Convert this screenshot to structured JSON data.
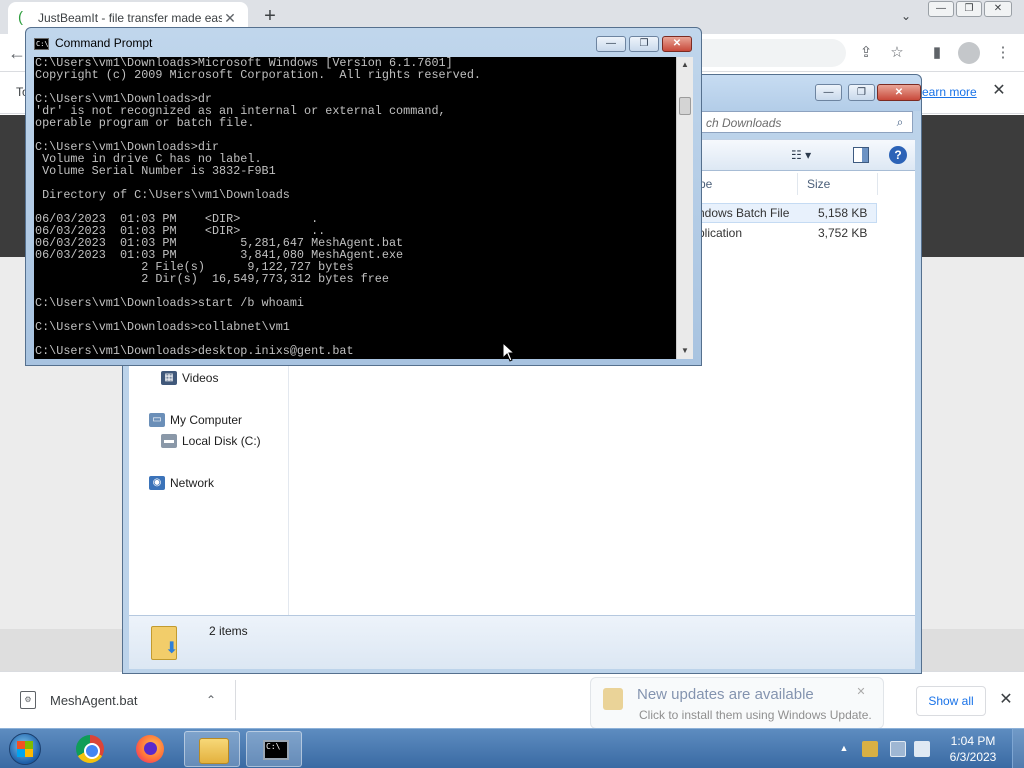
{
  "chrome": {
    "tab_title": "JustBeamIt - file transfer made easy",
    "tab_close": "✕",
    "new_tab": "+",
    "tab_search": "⌄",
    "window_controls": [
      "—",
      "❐",
      "✕"
    ],
    "toolbar": {
      "back": "←",
      "share": "⇪",
      "bookmark": "☆",
      "side_panel": "▮",
      "menu": "⋮"
    },
    "infobar": {
      "text": "To",
      "link": "earn more",
      "close": "✕"
    },
    "downloads": {
      "file_name": "MeshAgent.bat",
      "chevron": "⌃",
      "show_all": "Show all",
      "close": "✕"
    }
  },
  "explorer": {
    "window_controls": [
      "—",
      "❐",
      "✕"
    ],
    "search_placeholder": "ch Downloads",
    "search_icon": "⌕",
    "views_label": "☷ ▾",
    "help_label": "?",
    "nav": {
      "videos": "Videos",
      "my_computer": "My Computer",
      "local_disk": "Local Disk (C:)",
      "network": "Network"
    },
    "columns": {
      "type": "pe",
      "size": "Size"
    },
    "files": [
      {
        "type": "ndows Batch File",
        "size": "5,158 KB"
      },
      {
        "type": "plication",
        "size": "3,752 KB"
      }
    ],
    "item_count": "2 items"
  },
  "cmd": {
    "title": "Command Prompt",
    "icon_text": "C:\\",
    "window_controls": [
      "—",
      "❐",
      "✕"
    ],
    "lines": [
      "C:\\Users\\vm1\\Downloads>Microsoft Windows [Version 6.1.7601]",
      "Copyright (c) 2009 Microsoft Corporation.  All rights reserved.",
      "",
      "C:\\Users\\vm1\\Downloads>dr",
      "'dr' is not recognized as an internal or external command,",
      "operable program or batch file.",
      "",
      "C:\\Users\\vm1\\Downloads>dir",
      " Volume in drive C has no label.",
      " Volume Serial Number is 3832-F9B1",
      "",
      " Directory of C:\\Users\\vm1\\Downloads",
      "",
      "06/03/2023  01:03 PM    <DIR>          .",
      "06/03/2023  01:03 PM    <DIR>          ..",
      "06/03/2023  01:03 PM         5,281,647 MeshAgent.bat",
      "06/03/2023  01:03 PM         3,841,080 MeshAgent.exe",
      "               2 File(s)      9,122,727 bytes",
      "               2 Dir(s)  16,549,773,312 bytes free",
      "",
      "C:\\Users\\vm1\\Downloads>start /b whoami",
      "",
      "C:\\Users\\vm1\\Downloads>collabnet\\vm1",
      "",
      "C:\\Users\\vm1\\Downloads>desktop.inixs@gent.bat"
    ],
    "scroll_up": "▲",
    "scroll_down": "▼"
  },
  "balloon": {
    "title": "New updates are available",
    "body": "Click to install them using Windows Update.",
    "close": "✕"
  },
  "taskbar": {
    "tray_arrow": "▲",
    "time": "1:04 PM",
    "date": "6/3/2023"
  }
}
